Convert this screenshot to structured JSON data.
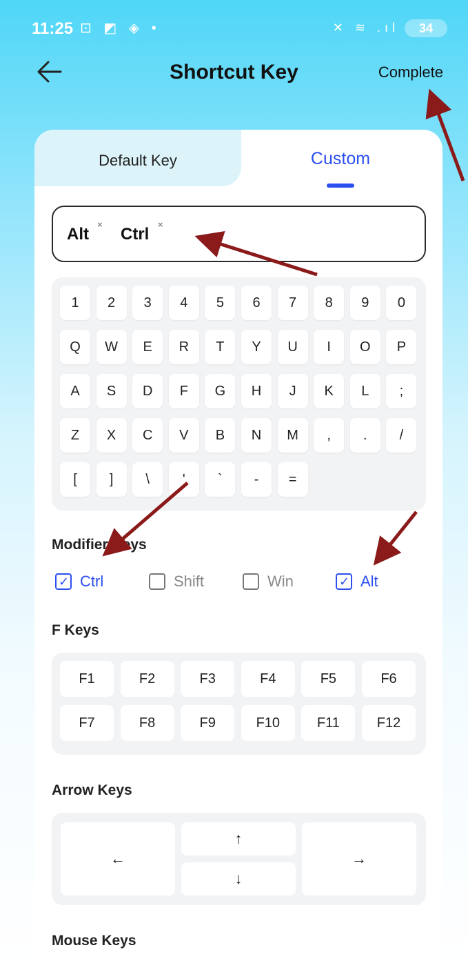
{
  "status": {
    "time": "11:25",
    "left_icons": "⊡ ◩ ◈ •",
    "right_icons": "✕ ≋ .ıl",
    "battery": "34"
  },
  "header": {
    "title": "Shortcut Key",
    "complete": "Complete"
  },
  "tabs": {
    "default": "Default Key",
    "custom": "Custom"
  },
  "combo": {
    "chips": [
      "Alt",
      "Ctrl"
    ],
    "remove": "×"
  },
  "keyboard": {
    "row1": [
      "1",
      "2",
      "3",
      "4",
      "5",
      "6",
      "7",
      "8",
      "9",
      "0"
    ],
    "row2": [
      "Q",
      "W",
      "E",
      "R",
      "T",
      "Y",
      "U",
      "I",
      "O",
      "P"
    ],
    "row3": [
      "A",
      "S",
      "D",
      "F",
      "G",
      "H",
      "J",
      "K",
      "L",
      ";"
    ],
    "row4": [
      "Z",
      "X",
      "C",
      "V",
      "B",
      "N",
      "M",
      ",",
      ".",
      "/"
    ],
    "row5": [
      "[",
      "]",
      "\\",
      "'",
      "`",
      "-",
      "="
    ]
  },
  "modifiers": {
    "label": "Modifier Keys",
    "items": [
      {
        "label": "Ctrl",
        "checked": true
      },
      {
        "label": "Shift",
        "checked": false
      },
      {
        "label": "Win",
        "checked": false
      },
      {
        "label": "Alt",
        "checked": true
      }
    ]
  },
  "fkeys": {
    "label": "F Keys",
    "keys": [
      "F1",
      "F2",
      "F3",
      "F4",
      "F5",
      "F6",
      "F7",
      "F8",
      "F9",
      "F10",
      "F11",
      "F12"
    ]
  },
  "arrows": {
    "label": "Arrow Keys",
    "left": "←",
    "up": "↑",
    "down": "↓",
    "right": "→"
  },
  "mouse": {
    "label": "Mouse Keys"
  },
  "colors": {
    "accent": "#2c4ff0",
    "annotation": "#8b1a1a"
  }
}
